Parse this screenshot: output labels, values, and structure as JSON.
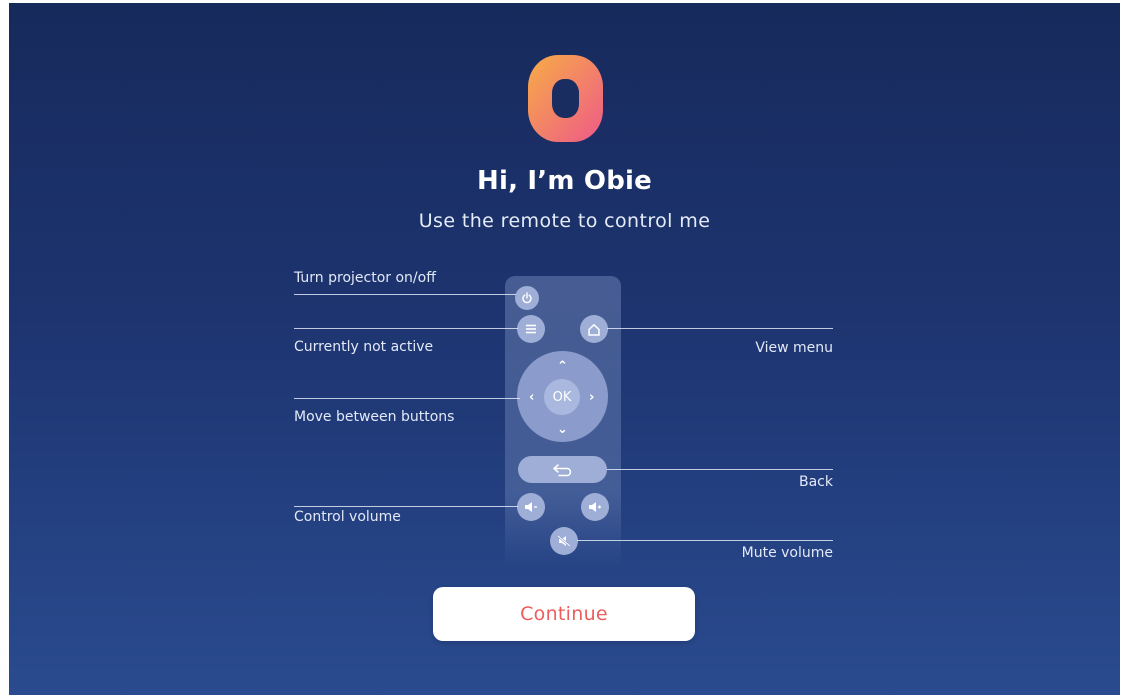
{
  "welcome": {
    "title": "Hi, I’m Obie",
    "subtitle": "Use the remote to control me"
  },
  "remote": {
    "ok_label": "OK",
    "labels": {
      "power": "Turn projector on/off",
      "menu": "Currently not active",
      "home": "View menu",
      "navigate": "Move between buttons",
      "back": "Back",
      "volume": "Control volume",
      "mute": "Mute volume"
    }
  },
  "continue_label": "Continue",
  "colors": {
    "background_top": "#172a5c",
    "background_bottom": "#2a4b8f",
    "logo_gradient_start": "#f6a64a",
    "logo_gradient_end": "#ee5c86",
    "continue_text": "#ec5d5b"
  },
  "icons": [
    "obie-logo-icon",
    "power-icon",
    "menu-icon",
    "home-icon",
    "chevron-up-icon",
    "chevron-down-icon",
    "chevron-left-icon",
    "chevron-right-icon",
    "back-arrow-icon",
    "volume-down-icon",
    "volume-up-icon",
    "mute-icon"
  ]
}
